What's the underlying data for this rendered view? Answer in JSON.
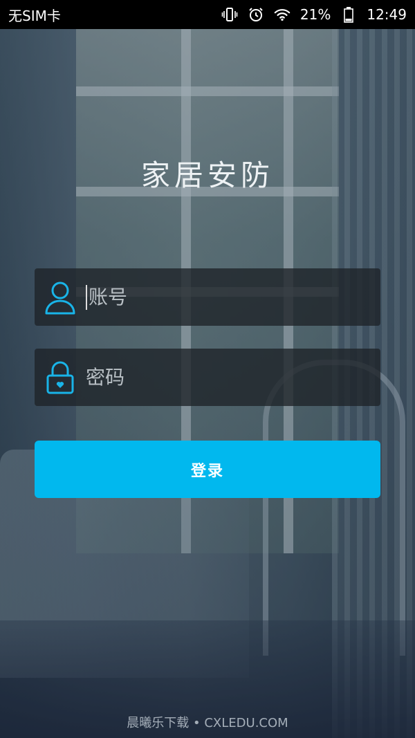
{
  "status_bar": {
    "carrier": "无SIM卡",
    "battery": "21%",
    "time": "12:49",
    "icons": [
      "vibrate-icon",
      "alarm-icon",
      "wifi-icon",
      "battery-icon"
    ]
  },
  "app": {
    "title": "家居安防"
  },
  "form": {
    "account_placeholder": "账号",
    "account_value": "",
    "password_placeholder": "密码",
    "password_value": "",
    "login_label": "登录"
  },
  "colors": {
    "accent": "#01b8ee",
    "field_bg": "#1e2328",
    "icon": "#19b4e8"
  },
  "watermark": "晨曦乐下载 • CXLEDU.COM"
}
